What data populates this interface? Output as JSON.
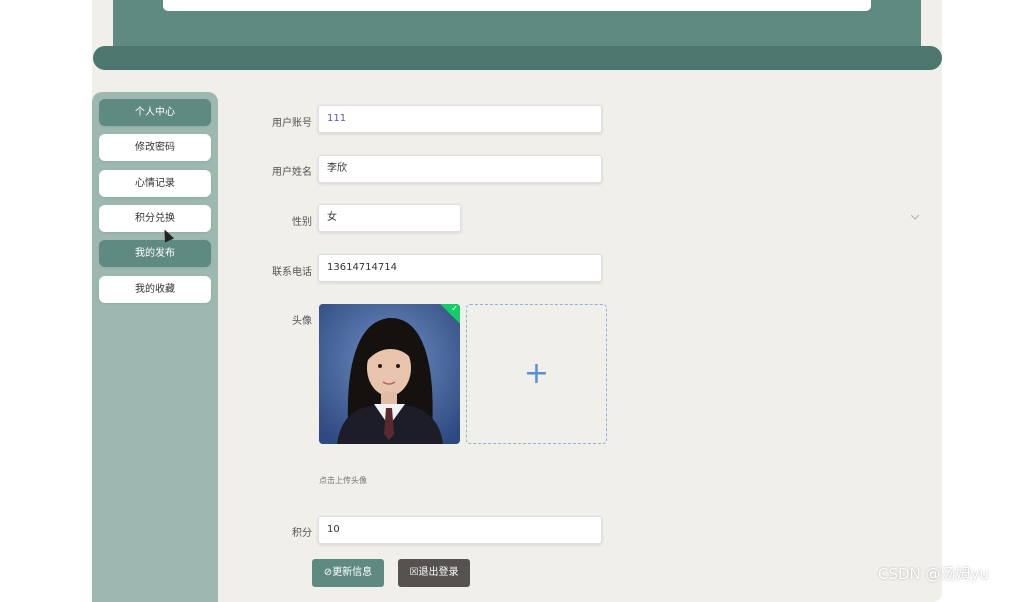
{
  "sidebar": {
    "items": [
      {
        "label": "个人中心",
        "active": true
      },
      {
        "label": "修改密码",
        "active": false
      },
      {
        "label": "心情记录",
        "active": false
      },
      {
        "label": "积分兑换",
        "active": false
      },
      {
        "label": "我的发布",
        "active": true
      },
      {
        "label": "我的收藏",
        "active": false
      }
    ]
  },
  "form": {
    "account_label": "用户账号",
    "account_value": "111",
    "name_label": "用户姓名",
    "name_value": "李欣",
    "gender_label": "性别",
    "gender_value": "女",
    "phone_label": "联系电话",
    "phone_value": "13614714714",
    "avatar_label": "头像",
    "avatar_hint": "点击上传头像",
    "upload_glyph": "+",
    "points_label": "积分",
    "points_value": "10"
  },
  "buttons": {
    "update_label": "更新信息",
    "logout_label": "退出登录"
  },
  "watermark": "CSDN @汤姆yu",
  "colors": {
    "accent": "#5f8a82",
    "sidebar_bg": "#9db8b0",
    "page_bg": "#f1efe9",
    "logout_btn": "#555250"
  },
  "icons": {
    "update": "check-circle-icon",
    "logout": "exit-icon",
    "select": "chevron-down-icon",
    "upload": "plus-icon",
    "uploaded": "check-icon"
  }
}
